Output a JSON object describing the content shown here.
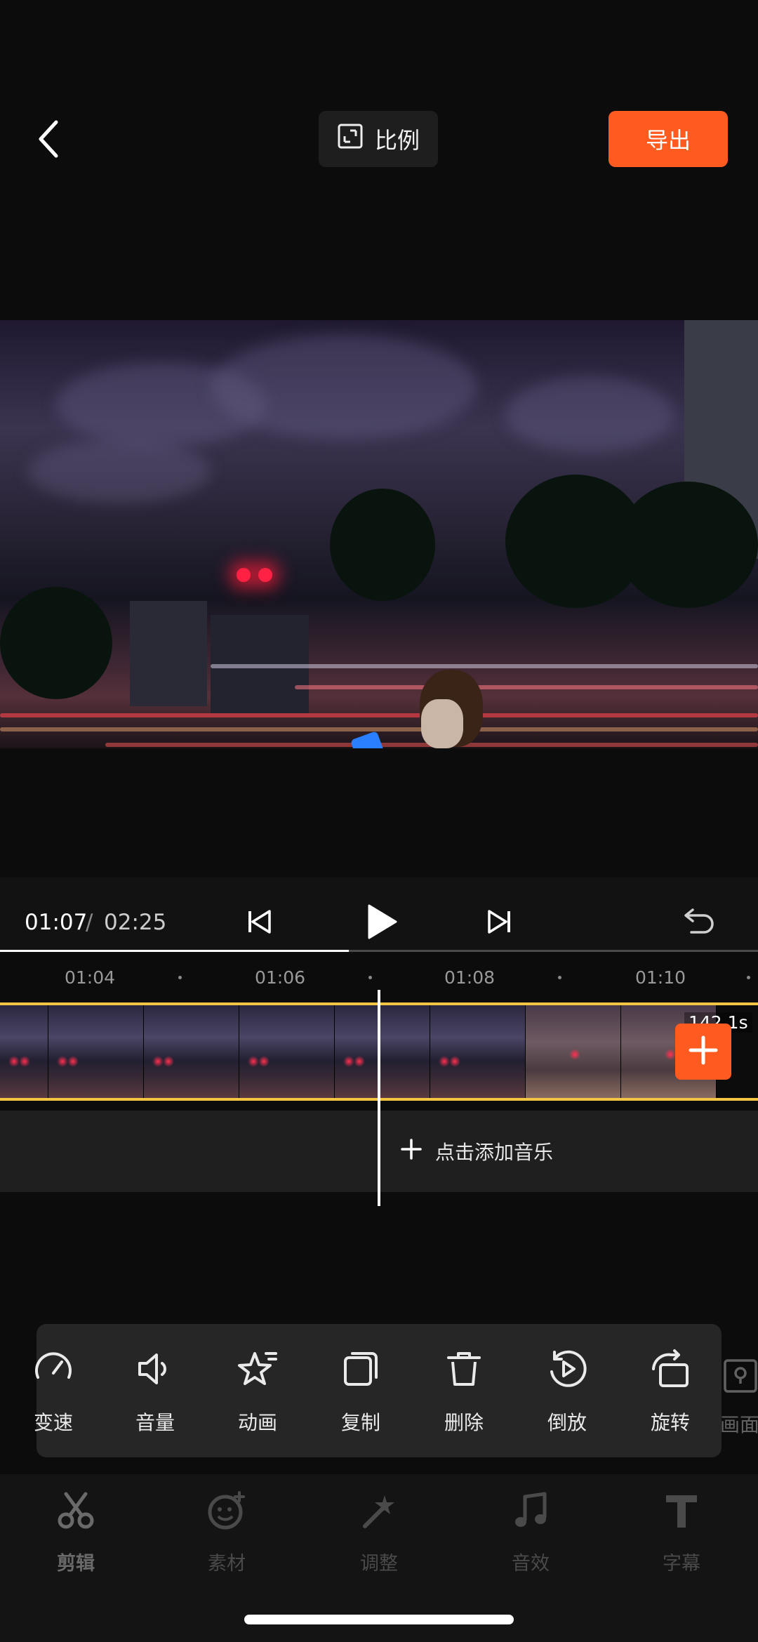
{
  "header": {
    "back_icon": "chevron-left-icon",
    "ratio_label": "比例",
    "ratio_icon": "aspect-ratio-icon",
    "export_label": "导出"
  },
  "colors": {
    "accent": "#ff5a1f",
    "clip_border": "#f4c542",
    "background": "#0c0c0c"
  },
  "player": {
    "current_time": "01:07",
    "separator": "/",
    "total_time": "02:25",
    "progress_fraction": 0.46,
    "icons": [
      "skip-back-icon",
      "play-icon",
      "skip-forward-icon",
      "undo-icon"
    ]
  },
  "timeline": {
    "ticks": [
      "01:04",
      "01:06",
      "01:08",
      "01:10"
    ],
    "clip_duration": "142.1s",
    "add_music_label": "点击添加音乐"
  },
  "tools": [
    {
      "label": "变速",
      "icon": "speed-gauge-icon"
    },
    {
      "label": "音量",
      "icon": "volume-icon"
    },
    {
      "label": "动画",
      "icon": "animation-star-icon"
    },
    {
      "label": "复制",
      "icon": "copy-icon"
    },
    {
      "label": "删除",
      "icon": "trash-icon"
    },
    {
      "label": "倒放",
      "icon": "reverse-play-icon"
    },
    {
      "label": "旋转",
      "icon": "rotate-icon"
    },
    {
      "label": "画面定",
      "icon": "freeze-frame-icon"
    }
  ],
  "bottom_nav": [
    {
      "label": "剪辑",
      "icon": "scissors-icon",
      "active": true
    },
    {
      "label": "素材",
      "icon": "sticker-icon"
    },
    {
      "label": "调整",
      "icon": "magic-wand-icon"
    },
    {
      "label": "音效",
      "icon": "music-note-icon"
    },
    {
      "label": "字幕",
      "icon": "text-t-icon"
    }
  ]
}
